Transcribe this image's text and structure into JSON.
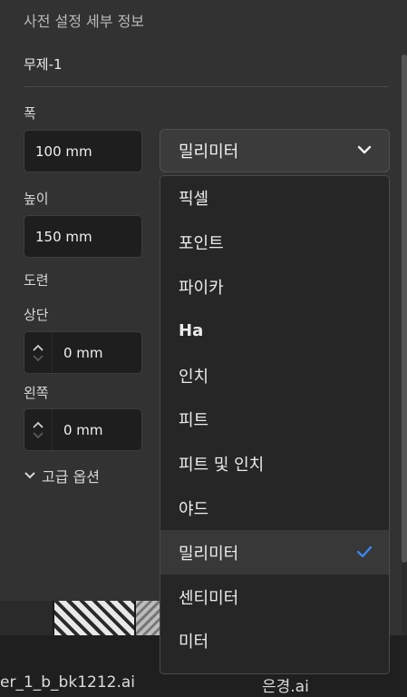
{
  "panel_title": "사전 설정 세부 정보",
  "doc_name": "무제-1",
  "width": {
    "label": "폭",
    "value": "100 mm"
  },
  "height": {
    "label": "높이",
    "value": "150 mm"
  },
  "units": {
    "selected": "밀리미터",
    "icon": "chevron-down-icon"
  },
  "bleed": {
    "label": "도련",
    "top": {
      "label": "상단",
      "value": "0 mm"
    },
    "left": {
      "label": "왼쪽",
      "value": "0 mm"
    }
  },
  "advanced_label": "고급 옵션",
  "dropdown": {
    "items": [
      "픽셀",
      "포인트",
      "파이카",
      "Ha",
      "인치",
      "피트",
      "피트 및 인치",
      "야드",
      "밀리미터",
      "센티미터",
      "미터"
    ],
    "selected_index": 8,
    "check_color": "#3d8af7"
  },
  "files": {
    "left_name": "er_1_b_bk1212.ai",
    "right_name": "은경.ai"
  }
}
